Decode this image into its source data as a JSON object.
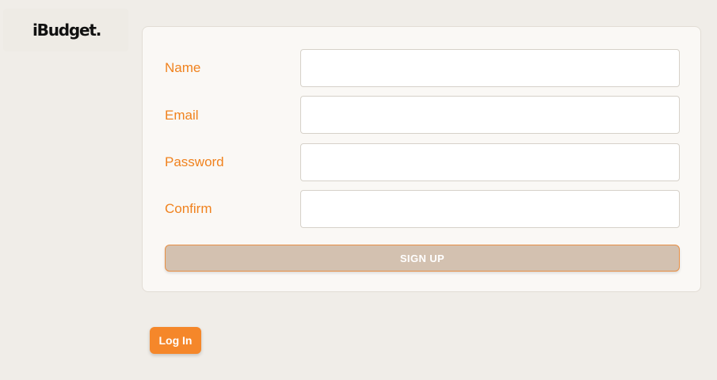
{
  "brand": {
    "name": "iBudget."
  },
  "signup_form": {
    "fields": [
      {
        "label": "Name",
        "value": ""
      },
      {
        "label": "Email",
        "value": ""
      },
      {
        "label": "Password",
        "value": ""
      },
      {
        "label": "Confirm",
        "value": ""
      }
    ],
    "submit_label": "SIGN UP"
  },
  "login": {
    "label": "Log In"
  },
  "colors": {
    "accent": "#f5872a",
    "label": "#f0821e",
    "background": "#f0ede8",
    "card": "#faf8f5",
    "signup_button": "#d3c1b0"
  }
}
